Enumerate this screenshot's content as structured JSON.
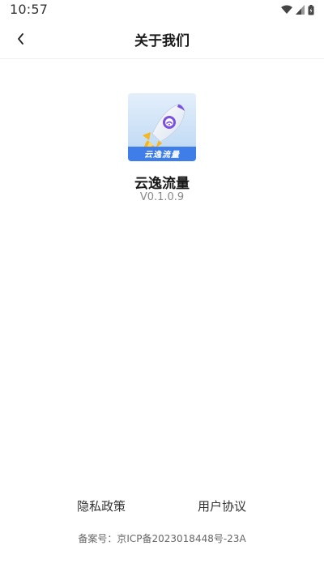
{
  "status_bar": {
    "time": "10:57",
    "icons": [
      "wifi-icon",
      "signal-icon",
      "battery-icon"
    ]
  },
  "header": {
    "back_icon": "chevron-left-icon",
    "title": "关于我们"
  },
  "app": {
    "logo_text": "云逸流量",
    "name": "云逸流量",
    "version": "V0.1.0.9"
  },
  "footer": {
    "privacy_label": "隐私政策",
    "agreement_label": "用户协议",
    "icp": "备案号：京ICP备2023018448号-23A"
  },
  "colors": {
    "logo_bg": "#cfe3f7",
    "logo_band": "#3f7ee8",
    "accent_yellow": "#f5b71f",
    "accent_purple": "#7b4fe0"
  }
}
